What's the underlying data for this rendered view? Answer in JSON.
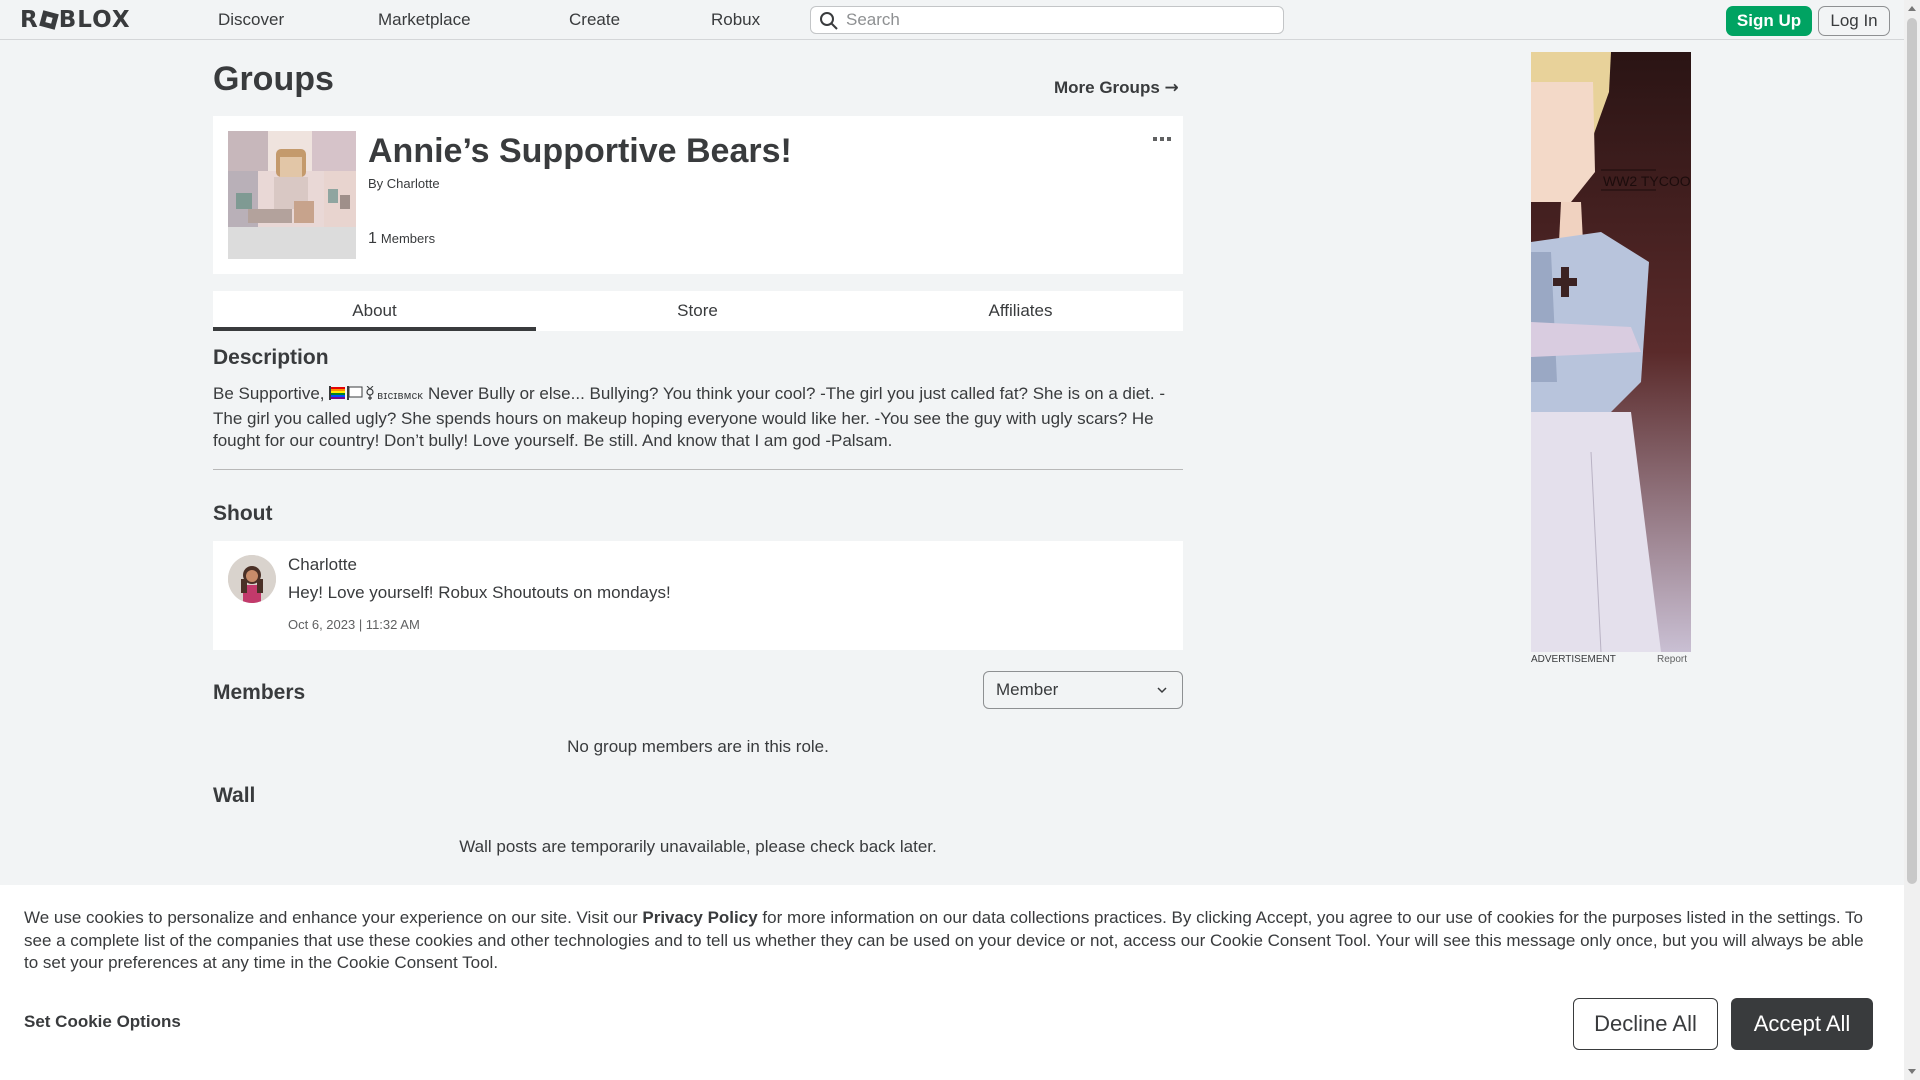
{
  "nav": {
    "logo": "ROBLOX",
    "items": [
      "Discover",
      "Marketplace",
      "Create",
      "Robux"
    ],
    "search_placeholder": "Search",
    "signup": "Sign Up",
    "login": "Log In"
  },
  "page": {
    "title": "Groups",
    "more_groups": "More Groups",
    "more_groups_arrow": "→"
  },
  "group": {
    "name": "Annie’s Supportive Bears!",
    "by_prefix": "By",
    "owner": "Charlotte",
    "member_count": "1",
    "members_label": "Members"
  },
  "tabs": [
    "About",
    "Store",
    "Affiliates"
  ],
  "description": {
    "heading": "Description",
    "text_prefix": "Be Supportive, ",
    "small_text": "ʙɪcɪʙмcκ",
    "text_rest": " Never Bully or else... Bullying? You think your cool? -The girl you just called fat? She is on a diet. -The girl you called ugly? She spends hours on makeup hoping everyone would like her. -You see the guy with ugly scars? He fought for our country! Don’t bully! Love yourself. Be still. And know that I am god -Palsam."
  },
  "shout": {
    "heading": "Shout",
    "author": "Charlotte",
    "body": "Hey! Love yourself! Robux Shoutouts on mondays!",
    "date": "Oct 6, 2023 | 11:32 AM"
  },
  "members": {
    "heading": "Members",
    "role_selected": "Member",
    "empty_message": "No group members are in this role."
  },
  "wall": {
    "heading": "Wall",
    "message": "Wall posts are temporarily unavailable, please check back later."
  },
  "ad": {
    "text": "WW2 TYCOON",
    "label": "ADVERTISEMENT",
    "report": "Report"
  },
  "cookie": {
    "text_before": "We use cookies to personalize and enhance your experience on our site. Visit our ",
    "policy_link": "Privacy Policy",
    "text_after": " for more information on our data collections practices. By clicking Accept, you agree to our use of cookies for the purposes listed in the settings. To see a complete list of the companies that use these cookies and other technologies and to tell us whether they can be used on your device or not, access our Cookie Consent Tool. Your will see this message only once, but you will always be able to set your preferences at any time in the Cookie Consent Tool.",
    "set_options": "Set Cookie Options",
    "decline": "Decline All",
    "accept": "Accept All"
  },
  "colors": {
    "accent_green": "#00a362",
    "text_dark": "#393b3d",
    "page_bg": "#f2f4f5"
  }
}
